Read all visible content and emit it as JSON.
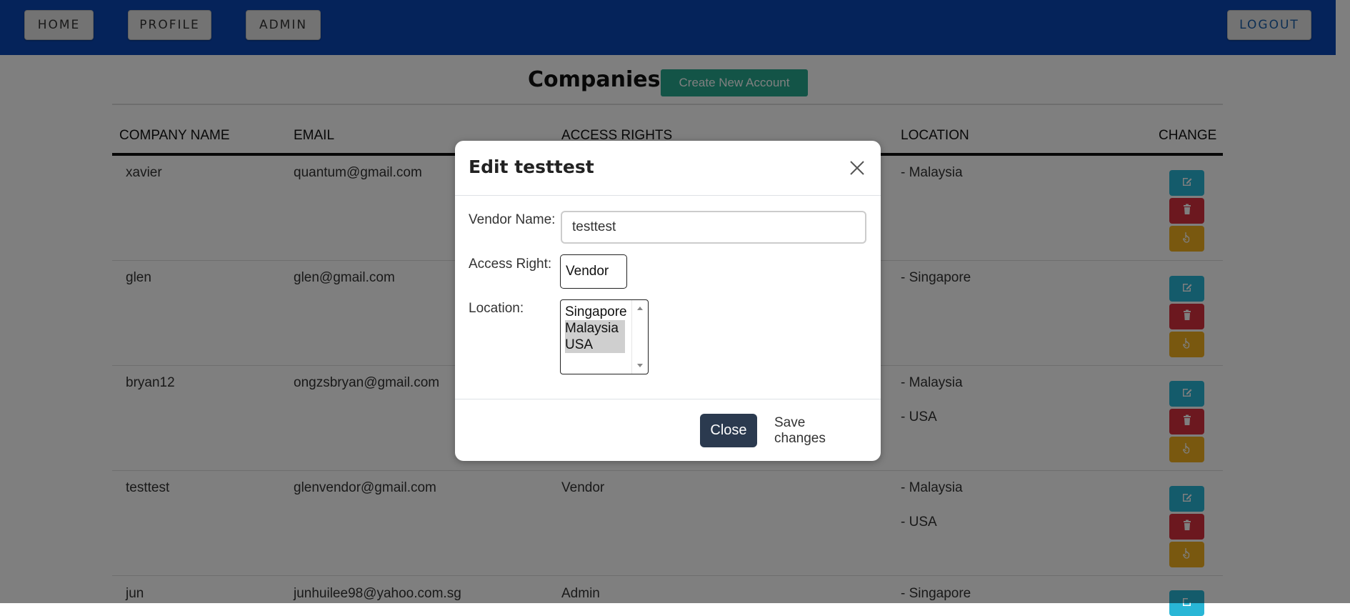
{
  "nav": {
    "home": "HOME",
    "profile": "PROFILE",
    "admin": "ADMIN",
    "logout": "LOGOUT"
  },
  "page": {
    "title": "Companies",
    "create_button": "Create New Account"
  },
  "table": {
    "headers": [
      "COMPANY NAME",
      "EMAIL",
      "ACCESS RIGHTS",
      "LOCATION",
      "CHANGE"
    ],
    "rows": [
      {
        "name": "xavier",
        "email": "quantum@gmail.com",
        "access": "",
        "locations": [
          "- Malaysia"
        ]
      },
      {
        "name": "glen",
        "email": "glen@gmail.com",
        "access": "",
        "locations": [
          "- Singapore"
        ]
      },
      {
        "name": "bryan12",
        "email": "ongzsbryan@gmail.com",
        "access": "",
        "locations": [
          "- Malaysia",
          "- USA"
        ]
      },
      {
        "name": "testtest",
        "email": "glenvendor@gmail.com",
        "access": "Vendor",
        "locations": [
          "- Malaysia",
          "- USA"
        ]
      },
      {
        "name": "jun",
        "email": "junhuilee98@yahoo.com.sg",
        "access": "Admin",
        "locations": [
          "- Singapore"
        ]
      }
    ]
  },
  "modal": {
    "title": "Edit testtest",
    "vendor_name_label": "Vendor Name:",
    "vendor_name_value": "testtest",
    "access_right_label": "Access Right:",
    "access_right_value": "Vendor",
    "location_label": "Location:",
    "location_options": [
      {
        "label": "Singapore",
        "selected": false
      },
      {
        "label": "Malaysia",
        "selected": true
      },
      {
        "label": "USA",
        "selected": true
      }
    ],
    "close_button": "Close",
    "save_button": "Save changes"
  },
  "icons": {
    "edit": "edit-icon",
    "delete": "trash-icon",
    "select": "hand-pointer-icon",
    "close": "close-icon"
  },
  "colors": {
    "navbar": "#0b47b5",
    "create_button": "#26a88f",
    "edit": "#29b6d6",
    "delete": "#d9313f",
    "select": "#f2b01e",
    "close_button": "#2b3a4f"
  }
}
